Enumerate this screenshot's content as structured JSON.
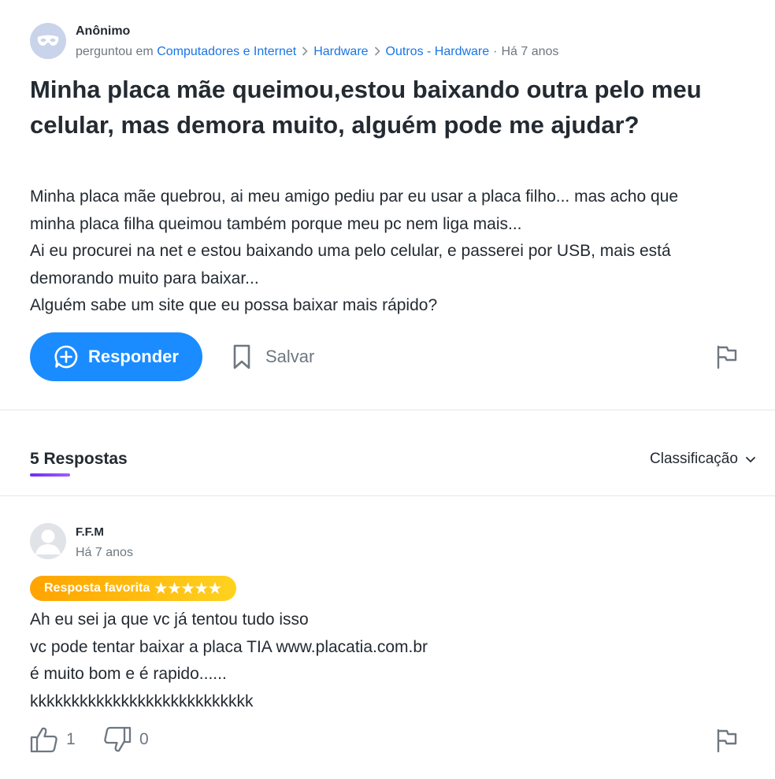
{
  "question": {
    "author": "Anônimo",
    "asked_prefix": "perguntou em",
    "breadcrumb": [
      "Computadores e Internet",
      "Hardware",
      "Outros - Hardware"
    ],
    "time": "Há 7 anos",
    "title": "Minha placa mãe queimou,estou baixando outra pelo meu celular, mas demora muito, alguém pode me ajudar?",
    "body_lines": [
      "Minha placa mãe quebrou, ai meu amigo pediu par eu usar a placa filho... mas acho que",
      "minha placa filha queimou também porque meu pc nem liga mais...",
      "Ai eu procurei na net e estou baixando uma pelo celular, e passerei por USB, mais está",
      "demorando muito para baixar...",
      "Alguém sabe um site que eu possa baixar mais rápido?"
    ],
    "actions": {
      "respond_label": "Responder",
      "save_label": "Salvar"
    }
  },
  "answers_section": {
    "count_label": "5 Respostas",
    "sort_label": "Classificação"
  },
  "answer": {
    "author": "F.F.M",
    "time": "Há 7 anos",
    "badge_label": "Resposta favorita",
    "badge_stars": "★★★★★",
    "body_lines": [
      "Ah eu sei ja que vc já tentou tudo isso",
      "vc pode tentar baixar a placa TIA  www.placatia.com.br",
      "é muito bom e é rapido......",
      "kkkkkkkkkkkkkkkkkkkkkkkkkkk"
    ],
    "likes": "1",
    "dislikes": "0"
  },
  "colors": {
    "accent": "#1a8cff",
    "link": "#1a75e5",
    "badge_start": "#ffa300",
    "badge_end": "#ffd21f",
    "underline": "#7b3cf6"
  },
  "icons": [
    "mask-icon",
    "chevron-right-icon",
    "plus-circle-icon",
    "bookmark-icon",
    "flag-icon",
    "chevron-down-icon",
    "user-icon",
    "thumbs-up-icon",
    "thumbs-down-icon",
    "star-icon"
  ]
}
